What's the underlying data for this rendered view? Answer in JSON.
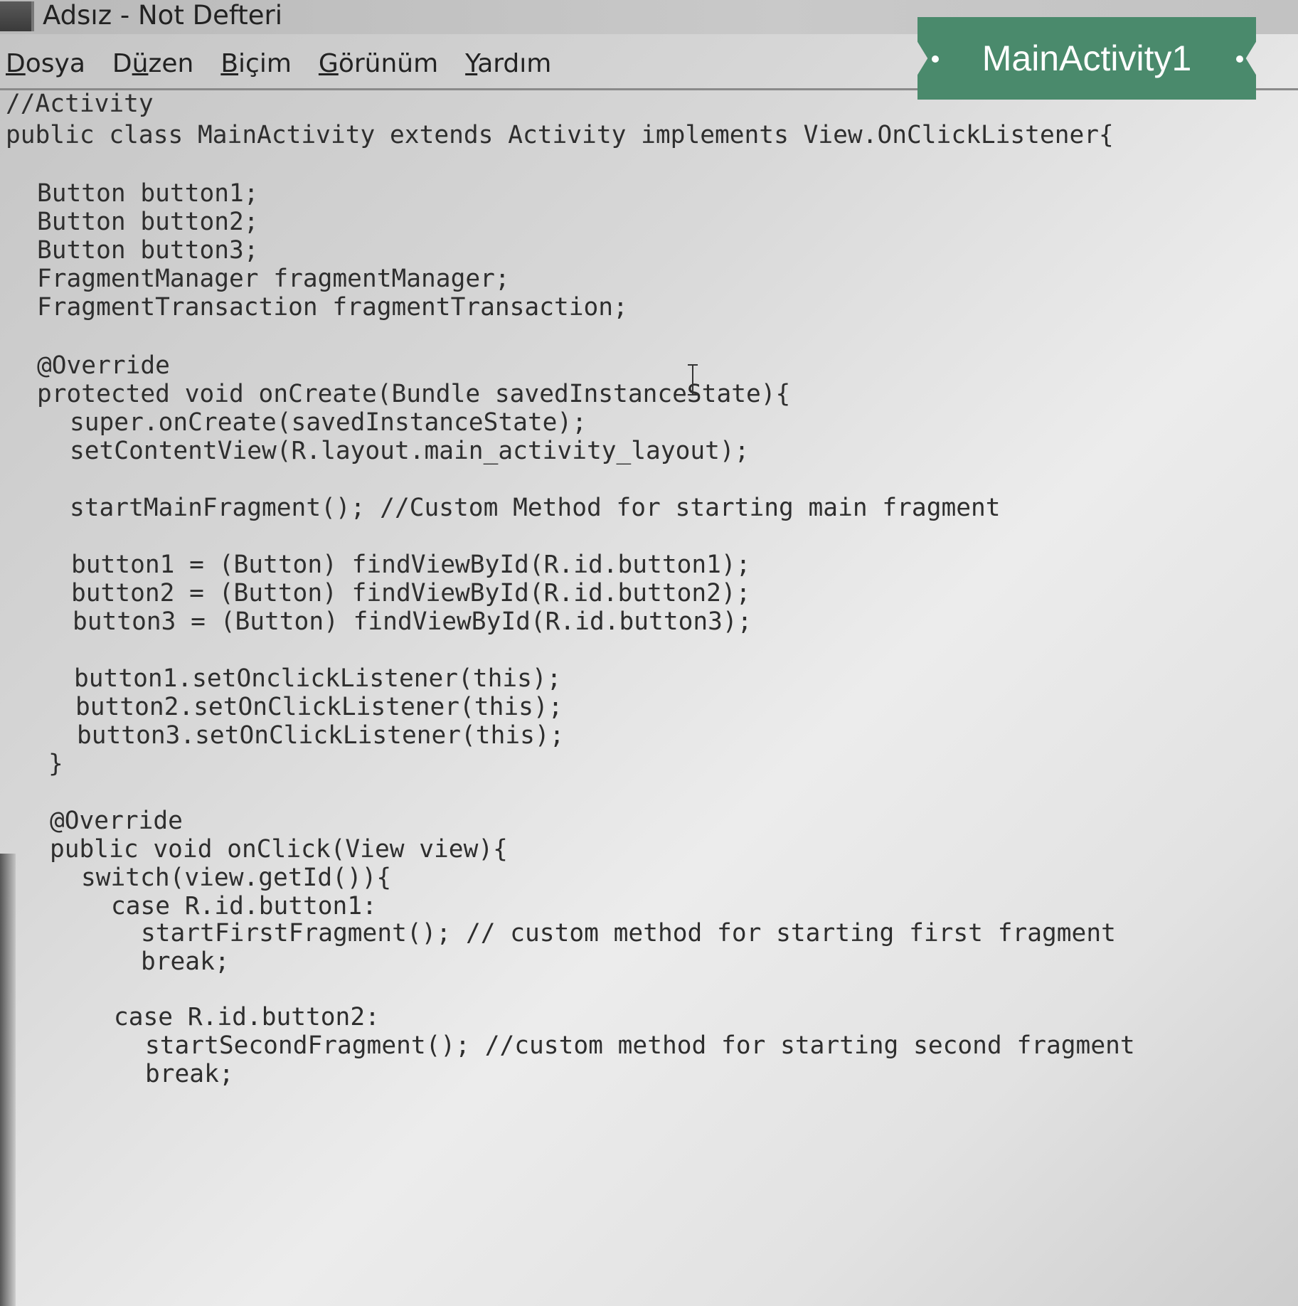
{
  "window": {
    "title": "Adsız - Not Defteri"
  },
  "menu": [
    {
      "mnemonic": "D",
      "rest": "osya"
    },
    {
      "mnemonic": "",
      "pre": "D",
      "mid": "ü",
      "rest": "zen"
    },
    {
      "mnemonic": "B",
      "rest": "içim"
    },
    {
      "mnemonic": "G",
      "rest": "örünüm"
    },
    {
      "mnemonic": "Y",
      "rest": "ardım"
    }
  ],
  "menu_labels": [
    "Dosya",
    "Düzen",
    "Biçim",
    "Görünüm",
    "Yardım"
  ],
  "tag": {
    "label": "MainActivity1",
    "color": "#4a8a6c"
  },
  "code": {
    "lines": [
      "//Activity",
      "public class MainActivity extends Activity implements View.OnClickListener{",
      "",
      "Button button1;",
      "Button button2;",
      "Button button3;",
      "FragmentManager fragmentManager;",
      "FragmentTransaction fragmentTransaction;",
      "",
      "@Override",
      "protected void onCreate(Bundle savedInstanceState){",
      "super.onCreate(savedInstanceState);",
      "setContentView(R.layout.main_activity_layout);",
      "",
      "startMainFragment(); //Custom Method for starting main fragment",
      "",
      "button1 = (Button) findViewById(R.id.button1);",
      "button2 = (Button) findViewById(R.id.button2);",
      "button3 = (Button) findViewById(R.id.button3);",
      "",
      "button1.setOnclickListener(this);",
      "button2.setOnClickListener(this);",
      "button3.setOnClickListener(this);",
      "}",
      "",
      "@Override",
      "public void onClick(View view){",
      "switch(view.getId()){",
      "case R.id.button1:",
      "startFirstFragment(); // custom method for starting first fragment",
      "break;",
      "",
      "case R.id.button2:",
      "startSecondFragment(); //custom method for starting second fragment",
      "break;"
    ]
  }
}
